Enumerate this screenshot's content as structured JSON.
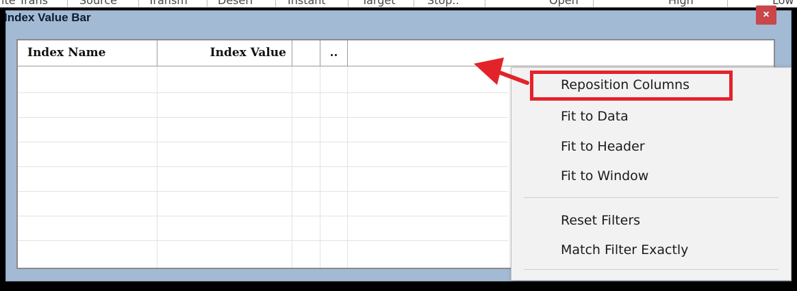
{
  "background_row": {
    "cells": [
      "ite Trans",
      "Source",
      "Transm",
      "Deseri",
      "Instant",
      "Target",
      "Stop..",
      "Open",
      "High",
      "Low"
    ]
  },
  "window": {
    "title": "Index Value Bar",
    "close_glyph": "×"
  },
  "grid": {
    "columns": [
      "Index Name",
      "Index Value",
      "",
      ".."
    ]
  },
  "context_menu": {
    "items": [
      {
        "label": "Reposition Columns",
        "highlighted": true
      },
      {
        "label": "Fit to Data"
      },
      {
        "label": "Fit to Header"
      },
      {
        "label": "Fit to Window"
      },
      {
        "label": "Reset Filters"
      },
      {
        "label": "Match Filter Exactly"
      }
    ]
  },
  "colors": {
    "title_bar": "#a3bad5",
    "close_button": "#c9464b",
    "annotation_red": "#e3232a",
    "menu_background": "#f2f2f2"
  }
}
